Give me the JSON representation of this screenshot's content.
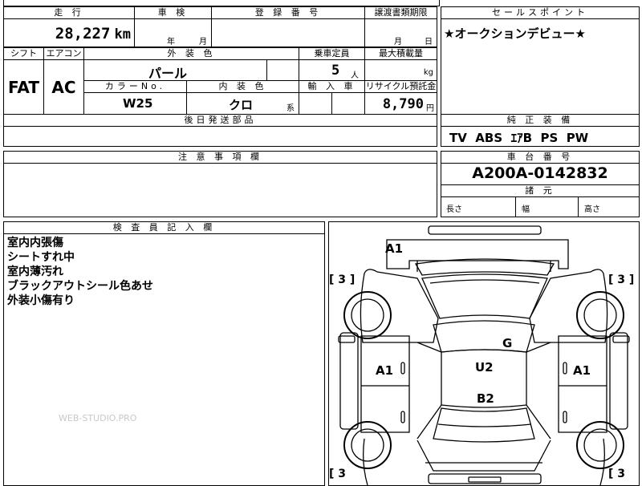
{
  "header": {
    "top_cut": "",
    "mileage_label": "走 行",
    "mileage_value": "28,227",
    "mileage_unit": "km",
    "inspection_label": "車 検",
    "inspection_year_unit": "年",
    "inspection_month_unit": "月",
    "registration_label": "登 録 番 号",
    "transfer_label": "譲渡書類期限",
    "transfer_month_unit": "月",
    "transfer_day_unit": "日",
    "selling_point_label": "セールスポイント",
    "selling_point_value": "★オークションデビュー★"
  },
  "specs": {
    "shift_label": "シフト",
    "shift_value": "FAT",
    "aircon_label": "エアコン",
    "aircon_value": "AC",
    "exterior_color_label": "外 装 色",
    "exterior_color_value": "パール",
    "capacity_label": "乗車定員",
    "capacity_value": "5",
    "capacity_unit": "人",
    "max_load_label": "最大積載量",
    "max_load_unit": "kg",
    "color_no_label": "カラーNo.",
    "color_no_value": "W25",
    "interior_color_label": "内 装 色",
    "interior_color_value": "クロ",
    "interior_color_suffix": "系",
    "import_label": "輸 入 車",
    "recycle_label": "リサイクル預託金",
    "recycle_value": "8,790",
    "recycle_unit": "円",
    "later_parts_label": "後日発送部品",
    "genuine_label": "純 正 装 備",
    "genuine_value": "TV  ABS  ｴｱB  PS  PW"
  },
  "notes": {
    "caution_label": "注 意 事 項 欄",
    "chassis_label": "車 台 番 号",
    "chassis_value": "A200A-0142832",
    "dimensions_label": "諸 元",
    "length_label": "長さ",
    "width_label": "幅",
    "height_label": "高さ"
  },
  "inspector": {
    "label": "検 査 員 記 入 欄",
    "lines": [
      "室内内張傷",
      "シートすれ中",
      "室内薄汚れ",
      "ブラックアウトシール色あせ",
      "外装小傷有り"
    ],
    "watermark": "WEB-STUDIO.PRO"
  },
  "diagram": {
    "front_mark": "A1",
    "bracket_tl": "[ 3 ]",
    "bracket_tr": "[ 3 ]",
    "bracket_bl": "[ 3",
    "bracket_br": "[ 3",
    "left_mark": "A1",
    "right_mark": "A1",
    "glass_mark": "G",
    "roof_mark": "U2",
    "center_mark": "B2"
  }
}
